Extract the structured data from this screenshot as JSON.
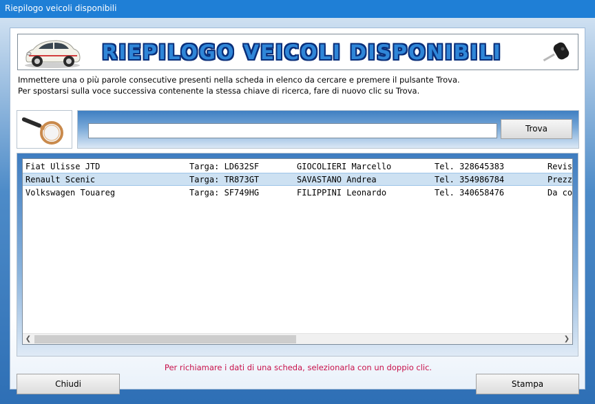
{
  "window": {
    "title": "Riepilogo veicoli disponibili"
  },
  "banner": {
    "title": "RIEPILOGO VEICOLI DISPONIBILI"
  },
  "instructions": {
    "line1": "Immettere una o più parole consecutive presenti nella scheda in elenco da cercare e premere il pulsante Trova.",
    "line2": "Per spostarsi sulla voce successiva contenente la stessa chiave di ricerca, fare di nuovo clic su Trova."
  },
  "search": {
    "value": "",
    "button_label": "Trova"
  },
  "list": {
    "rows": [
      {
        "model": "Fiat Ulisse JTD",
        "plate": "Targa: LD632SF",
        "owner": "GIOCOLIERI Marcello",
        "phone": "Tel. 328645383",
        "note": "Revis"
      },
      {
        "model": "Renault Scenic",
        "plate": "Targa: TR873GT",
        "owner": "SAVASTANO Andrea",
        "phone": "Tel. 354986784",
        "note": "Prezz"
      },
      {
        "model": "Volkswagen Touareg",
        "plate": "Targa: SF749HG",
        "owner": "FILIPPINI Leonardo",
        "phone": "Tel. 340658476",
        "note": "Da co"
      }
    ],
    "selected_row": 1
  },
  "hint": "Per richiamare i dati di una scheda, selezionarla con un doppio clic.",
  "buttons": {
    "close_label": "Chiudi",
    "print_label": "Stampa"
  },
  "colors": {
    "titlebar": "#1f7fd6",
    "hint": "#c8104a",
    "selection": "#cde1f2"
  }
}
